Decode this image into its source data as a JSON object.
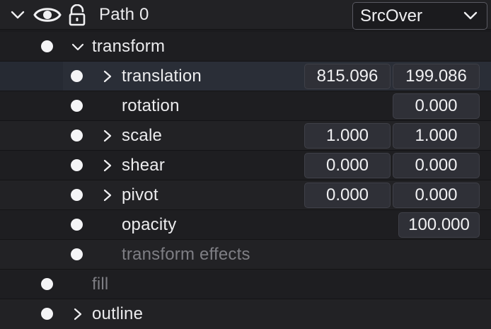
{
  "layer": {
    "name": "Path 0",
    "blend_mode": "SrcOver",
    "icons": {
      "collapse": "chevron-down-icon",
      "visibility": "eye-icon",
      "lock": "unlocked-padlock-icon",
      "dropdown": "chevron-down-icon"
    }
  },
  "props": {
    "transform": {
      "label": "transform"
    },
    "translation": {
      "label": "translation",
      "x": "815.096",
      "y": "199.086"
    },
    "rotation": {
      "label": "rotation",
      "value": "0.000"
    },
    "scale": {
      "label": "scale",
      "x": "1.000",
      "y": "1.000"
    },
    "shear": {
      "label": "shear",
      "x": "0.000",
      "y": "0.000"
    },
    "pivot": {
      "label": "pivot",
      "x": "0.000",
      "y": "0.000"
    },
    "opacity": {
      "label": "opacity",
      "value": "100.000"
    },
    "transform_effects": {
      "label": "transform effects"
    },
    "fill": {
      "label": "fill"
    },
    "outline": {
      "label": "outline"
    }
  },
  "colors": {
    "background": "#1b1b1e",
    "selected_row": "#2a2e37",
    "field": "#2f3037",
    "dim_text": "#7e7e84"
  }
}
